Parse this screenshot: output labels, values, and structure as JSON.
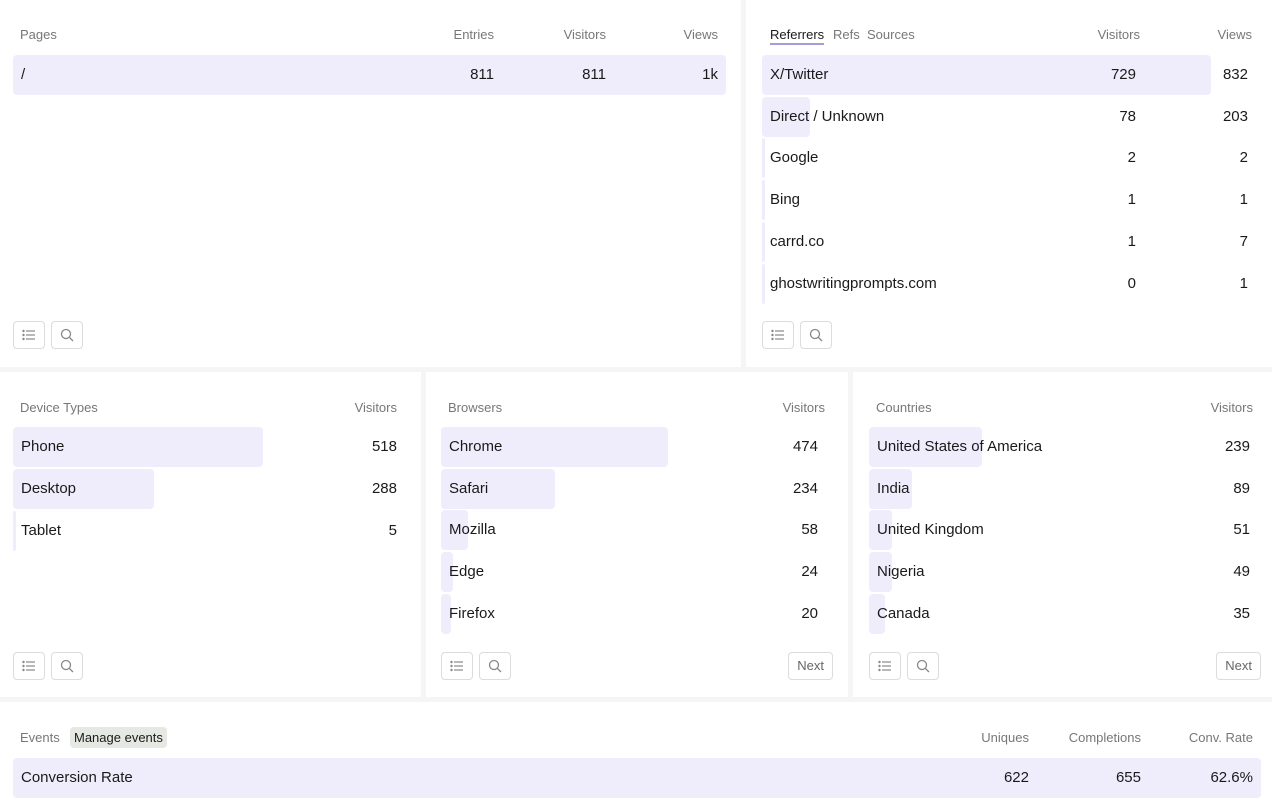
{
  "pages": {
    "title": "Pages",
    "columns": [
      "Entries",
      "Visitors",
      "Views"
    ],
    "rows": [
      {
        "label": "/",
        "entries": "811",
        "visitors": "811",
        "views": "1k",
        "share": 1.0
      }
    ]
  },
  "referrers": {
    "tabs": [
      "Referrers",
      "Refs",
      "Sources"
    ],
    "columns": [
      "Visitors",
      "Views"
    ],
    "rows": [
      {
        "label": "X/Twitter",
        "visitors": "729",
        "views": "832",
        "share": 1.0
      },
      {
        "label": "Direct / Unknown",
        "visitors": "78",
        "views": "203",
        "share": 0.107
      },
      {
        "label": "Google",
        "visitors": "2",
        "views": "2",
        "share": 0.003
      },
      {
        "label": "Bing",
        "visitors": "1",
        "views": "1",
        "share": 0.001
      },
      {
        "label": "carrd.co",
        "visitors": "1",
        "views": "7",
        "share": 0.001
      },
      {
        "label": "ghostwritingprompts.com",
        "visitors": "0",
        "views": "1",
        "share": 0.0
      }
    ]
  },
  "devices": {
    "title": "Device Types",
    "column": "Visitors",
    "rows": [
      {
        "label": "Phone",
        "value": "518",
        "share": 0.625
      },
      {
        "label": "Desktop",
        "value": "288",
        "share": 0.352
      },
      {
        "label": "Tablet",
        "value": "5",
        "share": 0.006
      }
    ]
  },
  "browsers": {
    "title": "Browsers",
    "column": "Visitors",
    "rows": [
      {
        "label": "Chrome",
        "value": "474",
        "share": 0.58
      },
      {
        "label": "Safari",
        "value": "234",
        "share": 0.29
      },
      {
        "label": "Mozilla",
        "value": "58",
        "share": 0.07
      },
      {
        "label": "Edge",
        "value": "24",
        "share": 0.03
      },
      {
        "label": "Firefox",
        "value": "20",
        "share": 0.025
      }
    ],
    "next_label": "Next"
  },
  "countries": {
    "title": "Countries",
    "column": "Visitors",
    "rows": [
      {
        "label": "United States of America",
        "value": "239",
        "share": 0.29
      },
      {
        "label": "India",
        "value": "89",
        "share": 0.11
      },
      {
        "label": "United Kingdom",
        "value": "51",
        "share": 0.06
      },
      {
        "label": "Nigeria",
        "value": "49",
        "share": 0.06
      },
      {
        "label": "Canada",
        "value": "35",
        "share": 0.04
      }
    ],
    "next_label": "Next"
  },
  "events": {
    "title": "Events",
    "manage_label": "Manage events",
    "columns": [
      "Uniques",
      "Completions",
      "Conv. Rate"
    ],
    "rows": [
      {
        "label": "Conversion Rate",
        "uniques": "622",
        "completions": "655",
        "rate": "62.6%",
        "share": 1.0
      }
    ]
  },
  "icons": {
    "list": "list-icon",
    "search": "search-icon"
  }
}
